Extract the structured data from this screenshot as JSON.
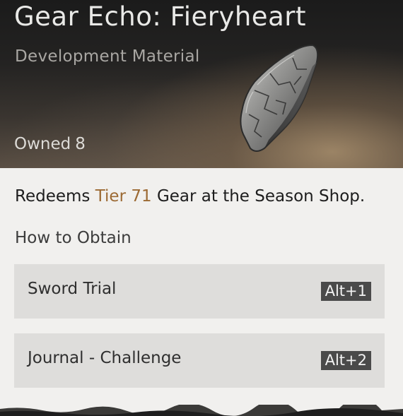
{
  "item": {
    "name": "Gear Echo: Fieryheart",
    "type": "Development Material",
    "owned_label": "Owned",
    "owned_count": "8",
    "image_icon": "gear-shard-icon"
  },
  "description": {
    "prefix": "Redeems",
    "highlight": "Tier 71",
    "suffix": "Gear at the Season Shop.",
    "highlight_color": "#9c6a34"
  },
  "obtain": {
    "title": "How to Obtain",
    "sources": [
      {
        "label": "Sword Trial",
        "hotkey": "Alt+1"
      },
      {
        "label": "Journal - Challenge",
        "hotkey": "Alt+2"
      }
    ]
  }
}
